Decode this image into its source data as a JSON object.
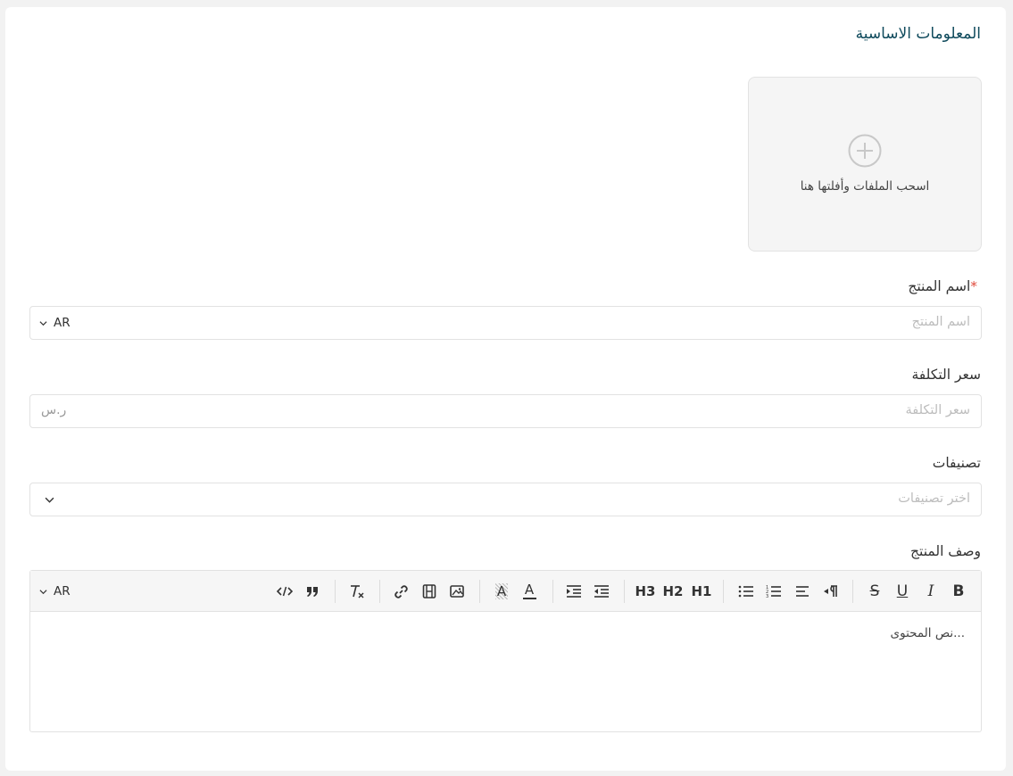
{
  "section": {
    "title": "المعلومات الاساسية"
  },
  "upload": {
    "text": "اسحب الملفات وأفلتها هنا"
  },
  "product_name": {
    "label": "اسم المنتج",
    "required_mark": "*",
    "placeholder": "اسم المنتج",
    "language": "AR"
  },
  "cost_price": {
    "label": "سعر التكلفة",
    "placeholder": "سعر التكلفة",
    "currency": "ر.س"
  },
  "categories": {
    "label": "تصنيفات",
    "placeholder": "اختر تصنيفات"
  },
  "description": {
    "label": "وصف المنتج",
    "language": "AR",
    "content": "...نص المحتوى",
    "toolbar": {
      "bold": "B",
      "italic": "I",
      "underline": "U",
      "strike": "S",
      "h1": "H1",
      "h2": "H2",
      "h3": "H3",
      "text_color": "A",
      "highlight": "A"
    }
  },
  "colors": {
    "accent_title": "#0f4a5c",
    "required": "#e04b3c"
  }
}
